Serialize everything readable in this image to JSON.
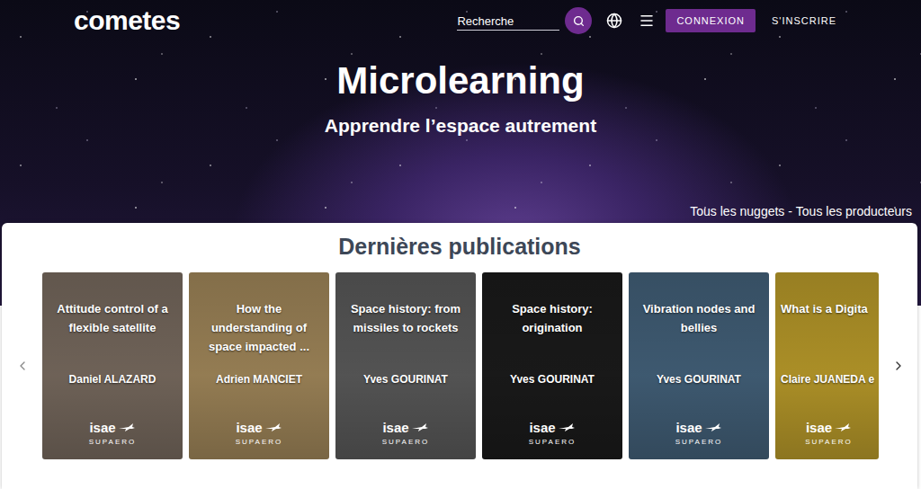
{
  "header": {
    "logo": "cometes",
    "search": {
      "placeholder": "Recherche"
    },
    "login": "CONNEXION",
    "signup": "S'INSCRIRE"
  },
  "hero": {
    "title": "Microlearning",
    "subtitle": "Apprendre l’espace autrement",
    "links": [
      "Tous les nuggets",
      "Tous les producteurs"
    ],
    "separator": " - "
  },
  "section": {
    "title": "Dernières publications"
  },
  "brand": {
    "name": "isae",
    "sub": "SUPAERO"
  },
  "cards": [
    {
      "title": "Attitude control of a flexible satellite",
      "author": "Daniel ALAZARD",
      "color": "#7d6f63",
      "partial": false
    },
    {
      "title": "How the understanding of space impacted ...",
      "author": "Adrien MANCIET",
      "color": "#a88d5e",
      "partial": false
    },
    {
      "title": "Space history: from missiles to rockets",
      "author": "Yves GOURINAT",
      "color": "#5e5e5e",
      "partial": false
    },
    {
      "title": "Space history: origination",
      "author": "Yves GOURINAT",
      "color": "#1c1c1c",
      "partial": false
    },
    {
      "title": "Vibration nodes and bellies",
      "author": "Yves GOURINAT",
      "color": "#46657f",
      "partial": false
    },
    {
      "title": "What is a Digita",
      "author": "Claire JUANEDA e",
      "color": "#c2a22c",
      "partial": true
    }
  ]
}
